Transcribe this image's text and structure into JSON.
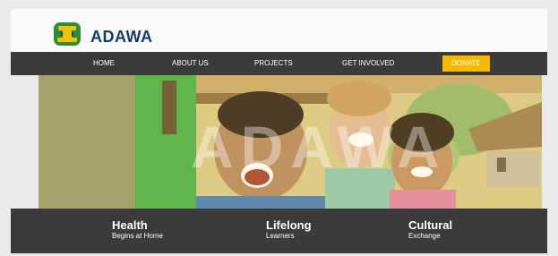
{
  "brand": {
    "name": "ADAWA",
    "logo_icon": "tribal-mask-icon"
  },
  "nav": {
    "items": [
      {
        "label": "HOME"
      },
      {
        "label": "ABOUT US"
      },
      {
        "label": "PROJECTS"
      },
      {
        "label": "GET INVOLVED"
      }
    ],
    "donate_label": "DONATE"
  },
  "hero": {
    "overlay_text": "ADAWA",
    "image": "children-and-volunteer-photo"
  },
  "features": [
    {
      "title": "Health",
      "subtitle": "Begins at Home"
    },
    {
      "title": "Lifelong",
      "subtitle": "Learners"
    },
    {
      "title": "Cultural",
      "subtitle": "Exchange"
    }
  ],
  "colors": {
    "brand_blue": "#143d6b",
    "nav_bg": "#3b3b3b",
    "donate": "#f6b800",
    "logo_green": "#2e8b3e"
  }
}
